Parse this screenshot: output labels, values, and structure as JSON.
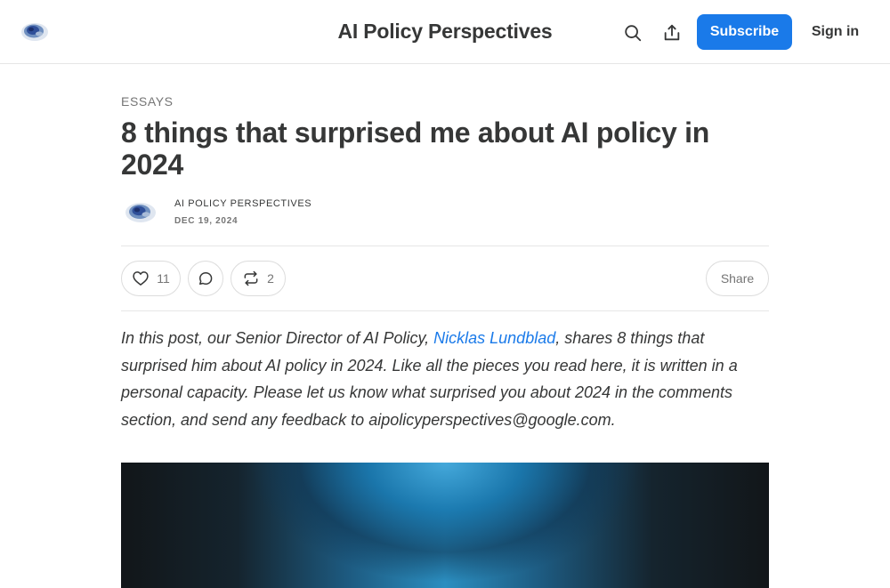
{
  "header": {
    "publication_title": "AI Policy Perspectives",
    "subscribe_label": "Subscribe",
    "signin_label": "Sign in",
    "icons": [
      "brain-logo-icon",
      "search-icon",
      "share-upload-icon"
    ],
    "accent_color": "#1a7ae9"
  },
  "article": {
    "section": "ESSAYS",
    "title": "8 things that surprised me about AI policy in 2024",
    "author": "AI POLICY PERSPECTIVES",
    "date": "DEC 19, 2024",
    "actions": {
      "likes": "11",
      "restacks": "2",
      "share_label": "Share",
      "icons": [
        "heart-icon",
        "comment-icon",
        "restack-icon"
      ]
    },
    "intro": {
      "before_link": "In this post, our Senior Director of AI Policy, ",
      "link_text": "Nicklas Lundblad",
      "after_link": ", shares 8 things that surprised him about AI policy in 2024. Like all the pieces you read here, it is written in a personal capacity. Please let us know what surprised you about 2024 in the comments section, and send any feedback to aipolicyperspectives@google.com."
    }
  }
}
